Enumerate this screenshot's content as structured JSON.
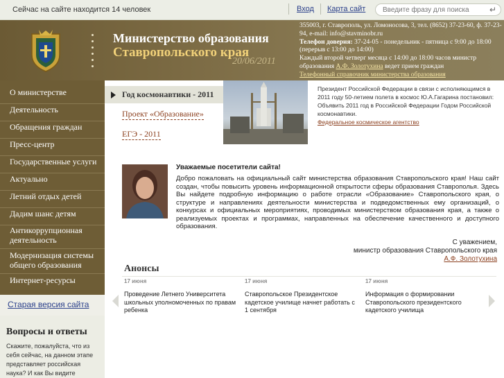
{
  "topbar": {
    "online_text": "Сейчас на сайте находится 14 человек",
    "login_label": "Вход",
    "sitemap_label": "Карта сайт",
    "search_placeholder": "Введите фразу для поиска",
    "search_go": "↵"
  },
  "header": {
    "title_line1": "Министерство образования",
    "title_line2": "Ставропольского края",
    "date": "20/06/2011",
    "contacts": {
      "address": "355003, г. Ставрополь, ул. Ломоносова, 3, тел. (8652) 37-23-60, ф. 37-23-94, e-mail: info@stavminobr.ru",
      "hotline_label": "Телефон доверия:",
      "hotline_text": " 37-24-05 - понедельник - пятница с 9:00 до 18:00 (перерыв с 13:00 до 14:00)",
      "reception_prefix": "Каждый второй четверг месяца с 14:00 до 18:00 часов министр образования ",
      "reception_name": "А.Ф. Золотухина",
      "reception_suffix": " ведет прием граждан",
      "phonebook_link": "Телефонный справочник министерства образования"
    }
  },
  "sidebar": {
    "items": [
      {
        "label": "О министерстве"
      },
      {
        "label": "Деятельность"
      },
      {
        "label": "Обращения граждан"
      },
      {
        "label": "Пресс-центр"
      },
      {
        "label": "Государственные услуги"
      },
      {
        "label": "Актуально"
      },
      {
        "label": "Летний отдых детей"
      },
      {
        "label": "Дадим шанс детям"
      },
      {
        "label": "Антикоррупционная деятельность"
      },
      {
        "label": "Модернизация системы общего образования"
      },
      {
        "label": "Интернет-ресурсы"
      }
    ],
    "old_version": "Старая версия сайта"
  },
  "qa": {
    "title": "Вопросы и ответы",
    "text": "Скажите, пожалуйста, что из себя сейчас, на данном этапе представляет российская наука? И как Вы видите стратегию работы учителя, желающего привести"
  },
  "feature": {
    "tab_label": "Год космонавтики - 2011",
    "link1": "Проект «Образование»",
    "link2": "ЕГЭ - 2011",
    "news_text": "Президент Российской Федерации в связи с исполняющимся в 2011 году 50-летием полета в космос Ю.А.Гагарина постановил: Объявить 2011 год в Российской Федерации Годом Российской космонавтики.",
    "news_link": "Федеральное космическое агентство"
  },
  "welcome": {
    "title": "Уважаемые посетители сайта!",
    "body": "Добро пожаловать на официальный сайт министерства образования Ставропольского края! Наш сайт создан, чтобы повысить уровень информационной открытости сферы образования Ставрополья. Здесь Вы найдете подробную информацию о работе отрасли «Образование» Ставропольского края, о структуре и направлениях деятельности министерства и подведомственных ему организаций, о конкурсах и официальных мероприятиях, проводимых министерством образования края, а также о реализуемых проектах и программах, направленных на обеспечение качественного и доступного образования.",
    "sign_regards": "С уважением,",
    "sign_position": "министр образования Ставропольского края",
    "sign_name": "А.Ф. Золотухина"
  },
  "announcements": {
    "title": "Анонсы",
    "items": [
      {
        "date": "17 июня",
        "text": "Проведение Летнего Университета школьных уполномоченных по правам ребенка"
      },
      {
        "date": "17 июня",
        "text": "Ставропольское Президентское кадетское училище начнет работать с 1 сентября"
      },
      {
        "date": "17 июня",
        "text": "Информация о формировании Ставропольского президентского кадетского училища"
      }
    ]
  }
}
